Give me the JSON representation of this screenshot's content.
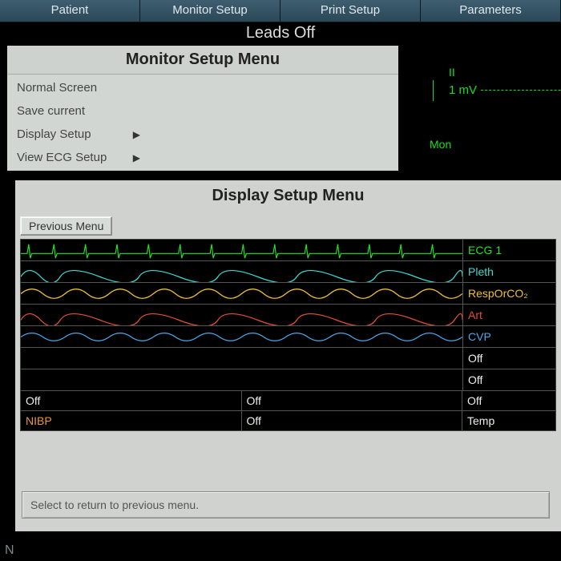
{
  "topbar": {
    "tabs": [
      "Patient",
      "Monitor Setup",
      "Print Setup",
      "Parameters"
    ]
  },
  "status": "Leads Off",
  "monitor_menu": {
    "title": "Monitor Setup Menu",
    "items": [
      {
        "label": "Normal Screen",
        "submenu": false
      },
      {
        "label": "Save current",
        "submenu": false
      },
      {
        "label": "Display Setup",
        "submenu": true
      },
      {
        "label": "View ECG Setup",
        "submenu": true
      }
    ]
  },
  "right_panel": {
    "lead": "II",
    "scale": "1 mV",
    "mode": "Mon"
  },
  "display_menu": {
    "title": "Display Setup Menu",
    "prev_button": "Previous Menu",
    "waveforms": [
      {
        "label": "ECG 1",
        "color": "#25e025"
      },
      {
        "label": "Pleth",
        "color": "#3dd8d0"
      },
      {
        "label": "RespOrCO₂",
        "color": "#f0c030"
      },
      {
        "label": "Art",
        "color": "#e05030"
      },
      {
        "label": "CVP",
        "color": "#4aa8e8"
      }
    ],
    "off_rows": [
      {
        "label": "Off"
      },
      {
        "label": "Off"
      }
    ],
    "grid_row1": [
      "Off",
      "Off",
      "Off"
    ],
    "grid_row2": [
      {
        "text": "NIBP",
        "color": "#e89838"
      },
      {
        "text": "Off",
        "color": "#eee"
      },
      {
        "text": "Temp",
        "color": "#eee"
      }
    ],
    "hint": "Select to return to previous menu."
  },
  "corner": "N"
}
